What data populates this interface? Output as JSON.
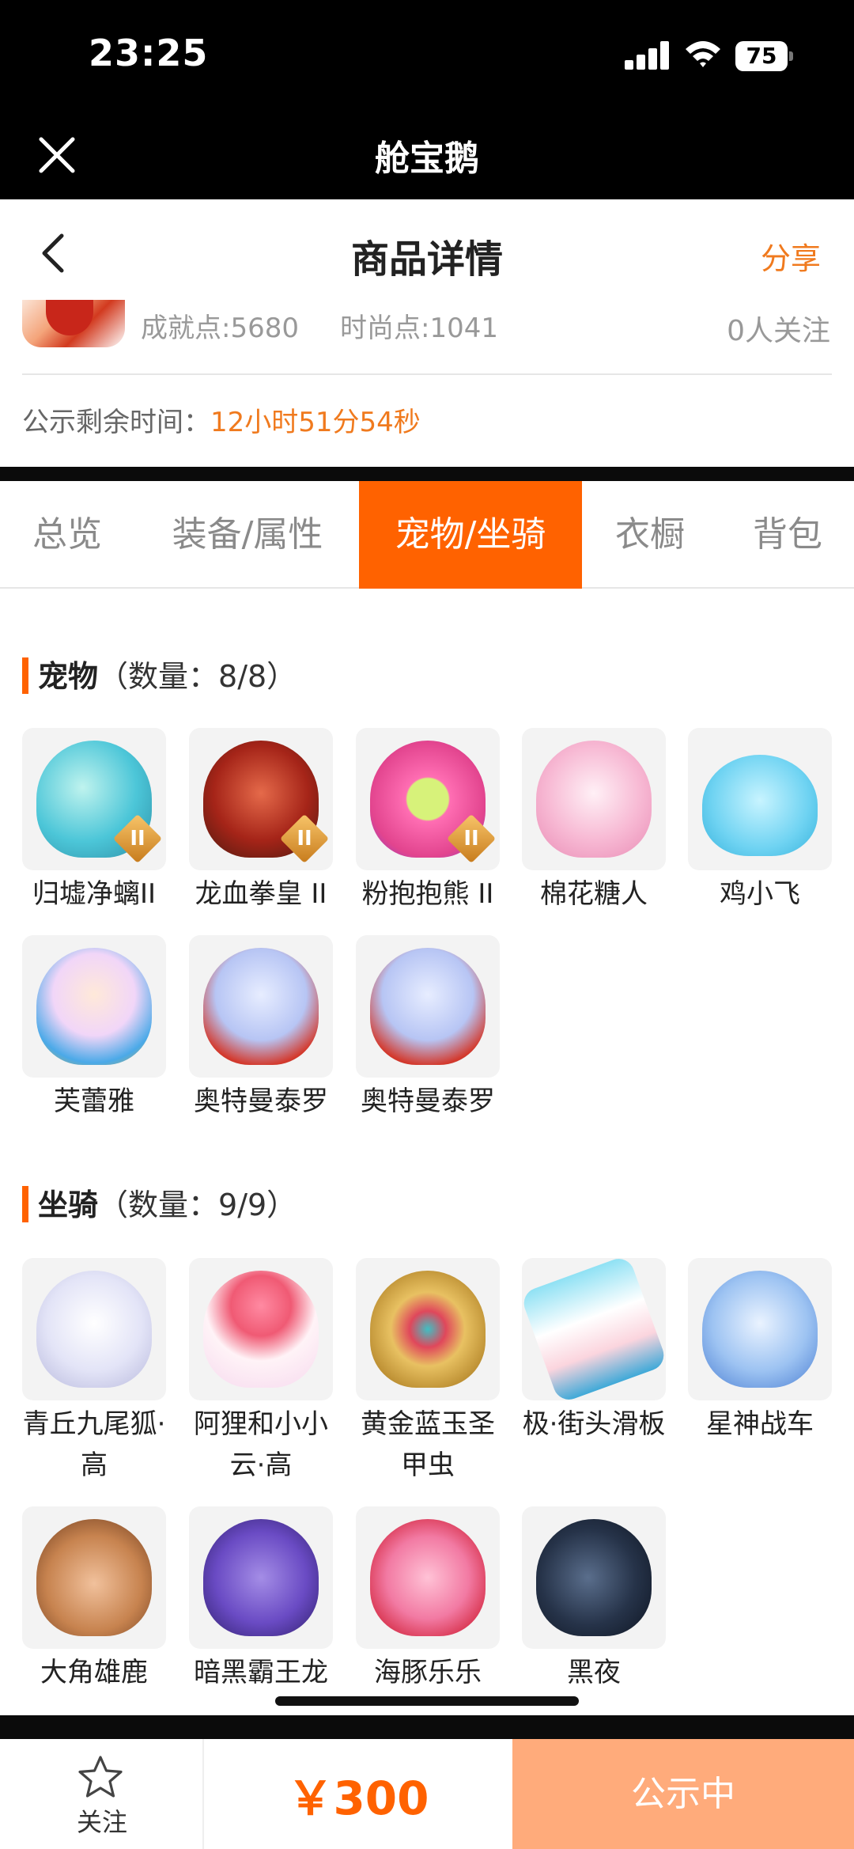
{
  "status_bar": {
    "time": "23:25",
    "battery": "75"
  },
  "app_header": {
    "title": "舱宝鹅"
  },
  "nav": {
    "title": "商品详情",
    "share": "分享"
  },
  "summary": {
    "achievement": "成就点:5680",
    "fashion": "时尚点:1041",
    "followers": "0人关注",
    "countdown_label": "公示剩余时间：",
    "countdown_value": "12小时51分54秒"
  },
  "tabs": [
    {
      "label": "总览"
    },
    {
      "label": "装备/属性"
    },
    {
      "label": "宠物/坐骑"
    },
    {
      "label": "衣橱"
    },
    {
      "label": "背包"
    }
  ],
  "pets": {
    "title": "宠物",
    "count": "（数量：8/8）",
    "items": [
      {
        "name": "归墟净螭II",
        "badge": "II",
        "icon": "cyan-dragon"
      },
      {
        "name": "龙血拳皇 II",
        "badge": "II",
        "icon": "red-horned-beast"
      },
      {
        "name": "粉抱抱熊 II",
        "badge": "II",
        "icon": "pink-bear"
      },
      {
        "name": "棉花糖人",
        "badge": "",
        "icon": "pink-cotton-creature"
      },
      {
        "name": "鸡小飞",
        "badge": "",
        "icon": "blue-chick"
      },
      {
        "name": "芙蕾雅",
        "badge": "",
        "icon": "goddess"
      },
      {
        "name": "奥特曼泰罗",
        "badge": "",
        "icon": "ultraman-taro"
      },
      {
        "name": "奥特曼泰罗",
        "badge": "",
        "icon": "ultraman-taro"
      }
    ]
  },
  "mounts": {
    "title": "坐骑",
    "count": "（数量：9/9）",
    "items": [
      {
        "name": "青丘九尾狐·高",
        "icon": "white-nine-tailed-fox"
      },
      {
        "name": "阿狸和小小云·高",
        "icon": "ahri-cloud"
      },
      {
        "name": "黄金蓝玉圣甲虫",
        "icon": "golden-scarab"
      },
      {
        "name": "极·街头滑板",
        "icon": "skateboard"
      },
      {
        "name": "星神战车",
        "icon": "blue-chariot-horse"
      },
      {
        "name": "大角雄鹿",
        "icon": "stag"
      },
      {
        "name": "暗黑霸王龙",
        "icon": "purple-dinosaur"
      },
      {
        "name": "海豚乐乐",
        "icon": "pink-dolphin"
      },
      {
        "name": "黑夜",
        "icon": "black-dragon"
      }
    ]
  },
  "bottom": {
    "follow": "关注",
    "price": "￥300",
    "status": "公示中"
  },
  "colors": {
    "accent": "#ff6200",
    "accent_light": "#ffab7b",
    "orange_text": "#f07a1e"
  }
}
